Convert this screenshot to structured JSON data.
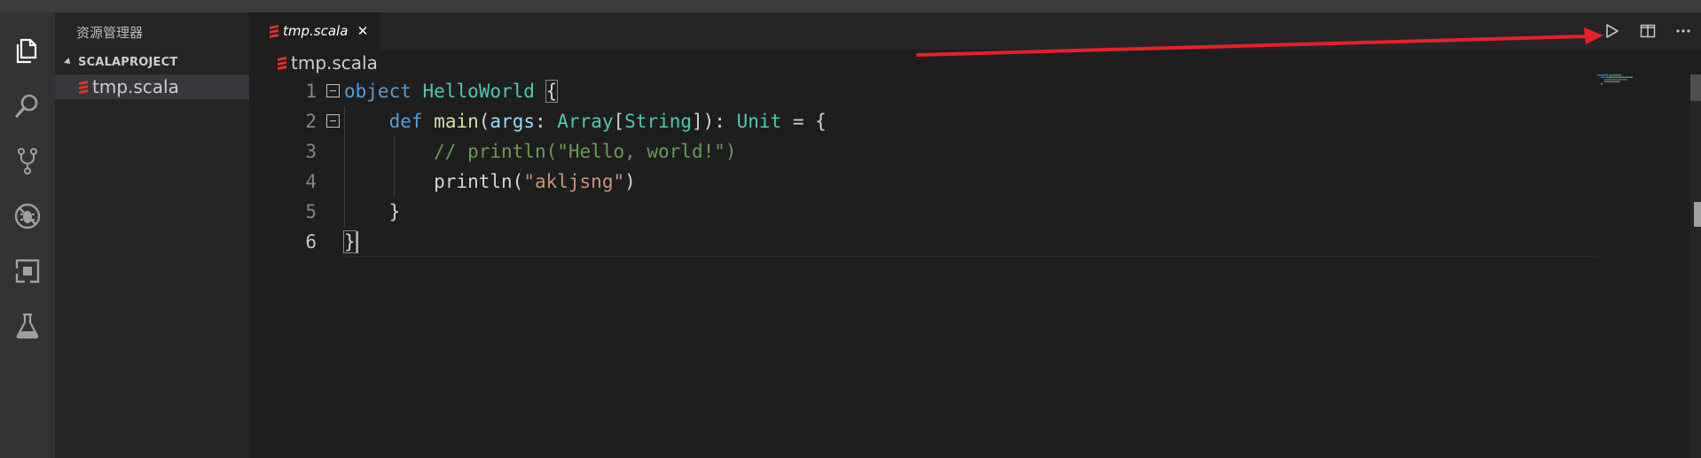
{
  "sidebar": {
    "title": "资源管理器",
    "section": "SCALAPROJECT",
    "files": [
      {
        "name": "tmp.scala"
      }
    ]
  },
  "tabs": [
    {
      "label": "tmp.scala",
      "close": "✕"
    }
  ],
  "breadcrumb": {
    "file": "tmp.scala"
  },
  "editor": {
    "line_numbers": [
      "1",
      "2",
      "3",
      "4",
      "5",
      "6"
    ],
    "lines": {
      "l1": {
        "kw": "object",
        "sp": " ",
        "name": "HelloWorld",
        "sp2": " ",
        "brace": "{"
      },
      "l2": {
        "indent": "    ",
        "kw": "def",
        "sp": " ",
        "fn": "main",
        "p1": "(",
        "param": "args",
        "p2": ": ",
        "type1": "Array",
        "p3": "[",
        "type2": "String",
        "p4": "]): ",
        "type3": "Unit",
        "p5": " = {"
      },
      "l3": {
        "indent": "        ",
        "comment": "// println(\"Hello, world!\")"
      },
      "l4": {
        "indent": "        ",
        "fn": "println",
        "p1": "(",
        "str": "\"akljsng\"",
        "p2": ")"
      },
      "l5": {
        "indent": "    ",
        "brace": "}"
      },
      "l6": {
        "brace": "}"
      }
    }
  },
  "colors": {
    "keyword": "#569cd6",
    "type": "#4ec9b0",
    "function": "#dcdcaa",
    "parameter": "#9cdcfe",
    "comment": "#6a9955",
    "string": "#ce9178",
    "annotation_arrow": "#e8202a",
    "scala_logo": "#de3423"
  },
  "icons": {
    "activity_bar": [
      "files-icon",
      "search-icon",
      "source-control-icon",
      "debug-icon",
      "extensions-icon",
      "test-flask-icon"
    ],
    "editor_actions": [
      "run-play-icon",
      "split-editor-icon",
      "more-actions-icon"
    ]
  }
}
